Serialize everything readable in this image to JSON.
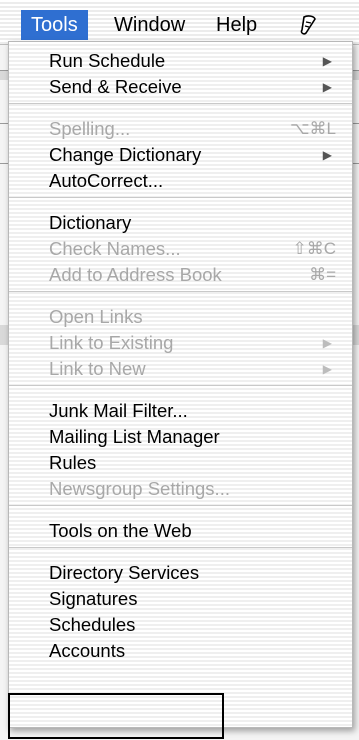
{
  "menubar": {
    "items": [
      {
        "label": "Tools",
        "active": true
      },
      {
        "label": "Window",
        "active": false
      },
      {
        "label": "Help",
        "active": false
      }
    ],
    "script_icon": "script-icon"
  },
  "tools_menu": {
    "groups": [
      [
        {
          "label": "Run Schedule",
          "enabled": true,
          "submenu": true
        },
        {
          "label": "Send & Receive",
          "enabled": true,
          "submenu": true
        }
      ],
      [
        {
          "label": "Spelling...",
          "enabled": false,
          "shortcut": "⌥⌘L"
        },
        {
          "label": "Change Dictionary",
          "enabled": true,
          "submenu": true
        },
        {
          "label": "AutoCorrect...",
          "enabled": true
        }
      ],
      [
        {
          "label": "Dictionary",
          "enabled": true
        },
        {
          "label": "Check Names...",
          "enabled": false,
          "shortcut": "⇧⌘C"
        },
        {
          "label": "Add to Address Book",
          "enabled": false,
          "shortcut": "⌘="
        }
      ],
      [
        {
          "label": "Open Links",
          "enabled": false
        },
        {
          "label": "Link to Existing",
          "enabled": false,
          "submenu": true
        },
        {
          "label": "Link to New",
          "enabled": false,
          "submenu": true
        }
      ],
      [
        {
          "label": "Junk Mail Filter...",
          "enabled": true
        },
        {
          "label": "Mailing List Manager",
          "enabled": true
        },
        {
          "label": "Rules",
          "enabled": true
        },
        {
          "label": "Newsgroup Settings...",
          "enabled": false
        }
      ],
      [
        {
          "label": "Tools on the Web",
          "enabled": true
        }
      ],
      [
        {
          "label": "Directory Services",
          "enabled": true
        },
        {
          "label": "Signatures",
          "enabled": true
        },
        {
          "label": "Schedules",
          "enabled": true
        },
        {
          "label": "Accounts",
          "enabled": true
        }
      ]
    ]
  },
  "colors": {
    "menu_highlight": "#2f6fd1",
    "disabled_text": "#a8a8a8",
    "separator": "#c9c9c9"
  }
}
